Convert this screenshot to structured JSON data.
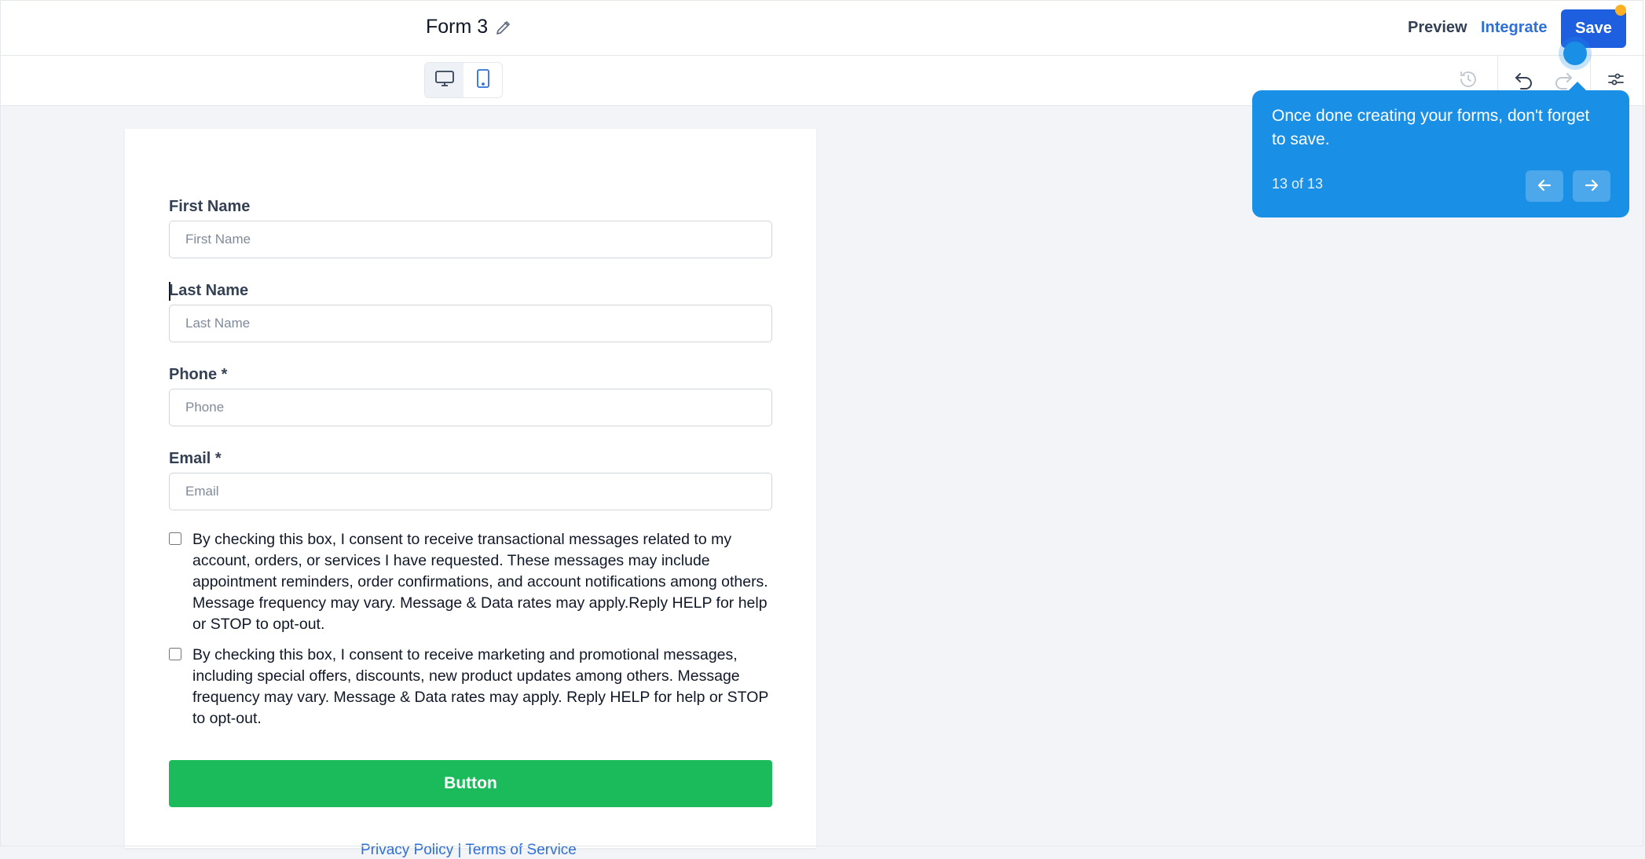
{
  "header": {
    "form_title": "Form 3",
    "preview_label": "Preview",
    "integrate_label": "Integrate",
    "save_label": "Save"
  },
  "form": {
    "fields": [
      {
        "label": "First Name",
        "placeholder": "First Name"
      },
      {
        "label": "Last Name",
        "placeholder": "Last Name"
      },
      {
        "label": "Phone *",
        "placeholder": "Phone"
      },
      {
        "label": "Email *",
        "placeholder": "Email"
      }
    ],
    "consents": [
      {
        "text": "By checking this box, I consent to receive transactional messages related to my account, orders, or services I have requested. These messages may include appointment reminders, order confirmations, and account notifications among others. Message frequency may vary. Message & Data rates may apply.Reply HELP for help or STOP to opt-out."
      },
      {
        "text": "By checking this box, I consent to receive marketing and promotional messages, including special offers, discounts, new product updates among others. Message frequency may vary. Message & Data rates may apply. Reply HELP for help or STOP to opt-out."
      }
    ],
    "button_label": "Button",
    "footer_links": "Privacy Policy | Terms of Service"
  },
  "tour": {
    "message": "Once done creating your forms, don't forget to save.",
    "step": "13 of 13"
  },
  "icons": {
    "title_edit": "pencil-icon",
    "desktop": "monitor-icon",
    "mobile": "mobile-icon",
    "history": "history-icon",
    "undo": "undo-icon",
    "redo": "redo-icon",
    "settings": "sliders-icon",
    "prev": "arrow-left-icon",
    "next": "arrow-right-icon"
  },
  "colors": {
    "primary": "#1e5fe0",
    "tour": "#1a8fe6",
    "submit": "#1bbb5c",
    "badge": "#fdb022"
  }
}
